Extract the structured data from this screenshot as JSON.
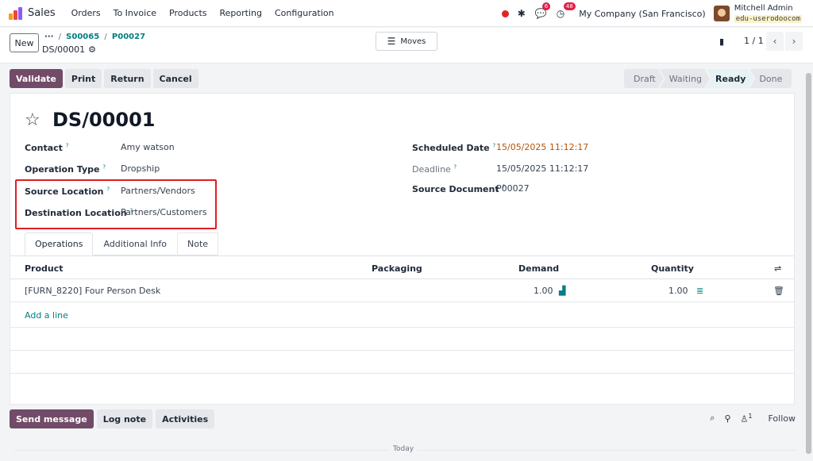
{
  "navbar": {
    "app_name": "Sales",
    "menu": [
      "Orders",
      "To Invoice",
      "Products",
      "Reporting",
      "Configuration"
    ],
    "messages_count": "6",
    "activities_count": "48",
    "company": "My Company (San Francisco)",
    "user_name": "Mitchell Admin",
    "db_name": "edu-userodoocom"
  },
  "control": {
    "new_label": "New",
    "breadcrumb_dots": "···",
    "breadcrumb_1": "S00065",
    "breadcrumb_2": "P00027",
    "current_record": "DS/00001",
    "moves_label": "Moves",
    "pager": "1 / 1"
  },
  "actions": [
    "Validate",
    "Print",
    "Return",
    "Cancel"
  ],
  "status_stages": [
    "Draft",
    "Waiting",
    "Ready",
    "Done"
  ],
  "status_active": "Ready",
  "form": {
    "title": "DS/00001",
    "contact_label": "Contact",
    "contact_value": "Amy watson",
    "operation_type_label": "Operation Type",
    "operation_type_value": "Dropship",
    "source_location_label": "Source Location",
    "source_location_value": "Partners/Vendors",
    "destination_location_label": "Destination Location",
    "destination_location_value": "Partners/Customers",
    "scheduled_date_label": "Scheduled Date",
    "scheduled_date_value": "15/05/2025 11:12:17",
    "deadline_label": "Deadline",
    "deadline_value": "15/05/2025 11:12:17",
    "source_document_label": "Source Document",
    "source_document_value": "P00027",
    "help_mark": "?"
  },
  "tabs": [
    "Operations",
    "Additional Info",
    "Note"
  ],
  "table": {
    "headers": {
      "product": "Product",
      "packaging": "Packaging",
      "demand": "Demand",
      "quantity": "Quantity"
    },
    "rows": [
      {
        "product": "[FURN_8220] Four Person Desk",
        "packaging": "",
        "demand": "1.00",
        "quantity": "1.00"
      }
    ],
    "add_line": "Add a line"
  },
  "chatter": {
    "send_message": "Send message",
    "log_note": "Log note",
    "activities": "Activities",
    "followers_count": "1",
    "follow": "Follow",
    "today": "Today"
  },
  "colors": {
    "primary": "#714b67",
    "link": "#017e84",
    "date_warning": "#b45309",
    "highlight": "#e11d24"
  }
}
